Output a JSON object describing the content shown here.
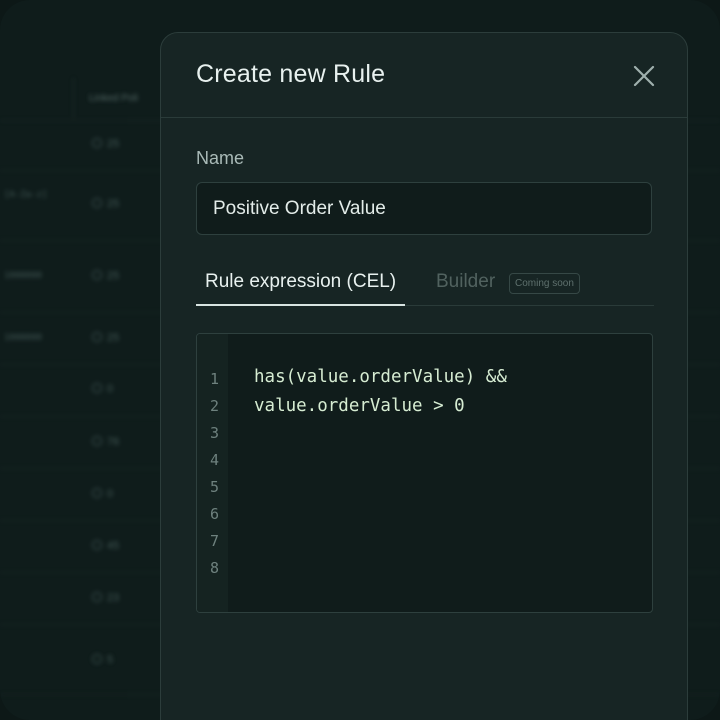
{
  "background_table": {
    "header": {
      "linked_label": "Linked Poli"
    },
    "rows": [
      {
        "left": "",
        "count": "25"
      },
      {
        "left": "[A-Za-z]",
        "count": "25"
      },
      {
        "left": "1000000",
        "count": "25"
      },
      {
        "left": "1000000",
        "count": "25"
      },
      {
        "left": "",
        "count": "0"
      },
      {
        "left": "",
        "count": "76"
      },
      {
        "left": "",
        "count": "0"
      },
      {
        "left": "",
        "count": "45"
      },
      {
        "left": "",
        "count": "23"
      },
      {
        "left": "",
        "count": "5"
      }
    ]
  },
  "modal": {
    "title": "Create new Rule",
    "close_icon": "close-icon",
    "name_label": "Name",
    "name_value": "Positive Order Value",
    "tabs": [
      {
        "label": "Rule expression (CEL)",
        "active": true
      },
      {
        "label": "Builder",
        "active": false,
        "badge": "Coming soon"
      }
    ],
    "editor": {
      "line_numbers": [
        "1",
        "2",
        "3",
        "4",
        "5",
        "6",
        "7",
        "8"
      ],
      "lines": [
        "has(value.orderValue) &&",
        "value.orderValue > 0"
      ]
    }
  },
  "colors": {
    "background": "#0f1c1b",
    "modal": "#172524",
    "code_text": "#d6ecd2",
    "muted_text": "#a9bab7"
  }
}
